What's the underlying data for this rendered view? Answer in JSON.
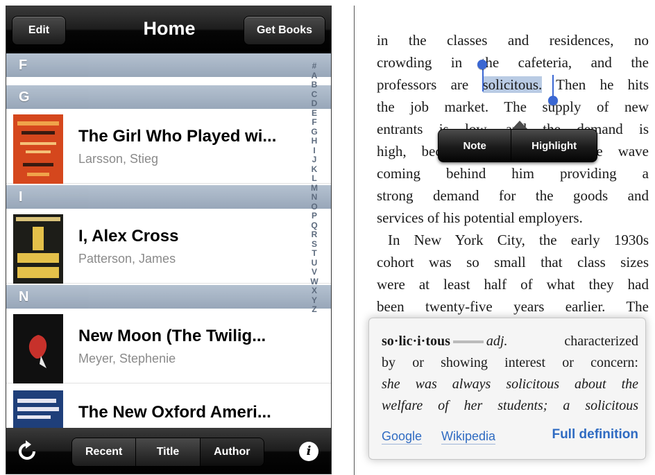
{
  "library": {
    "nav": {
      "edit": "Edit",
      "title": "Home",
      "get_books": "Get Books"
    },
    "sections": [
      "F",
      "G",
      "I",
      "N"
    ],
    "books": [
      {
        "title": "The Girl Who Played wi...",
        "author": "Larsson, Stieg",
        "cover_color": "#d5471d"
      },
      {
        "title": "I, Alex Cross",
        "author": "Patterson, James",
        "cover_color": "#1d1d18"
      },
      {
        "title": "New Moon (The Twilig...",
        "author": "Meyer, Stephenie",
        "cover_color": "#101010"
      },
      {
        "title": "The New Oxford Ameri...",
        "author": "",
        "cover_color": "#1f3f7a"
      }
    ],
    "index_letters": [
      "#",
      "A",
      "B",
      "C",
      "D",
      "E",
      "F",
      "G",
      "H",
      "I",
      "J",
      "K",
      "L",
      "M",
      "N",
      "O",
      "P",
      "Q",
      "R",
      "S",
      "T",
      "U",
      "V",
      "W",
      "X",
      "Y",
      "Z"
    ],
    "toolbar": {
      "segments": [
        "Recent",
        "Title",
        "Author"
      ],
      "active": "Author",
      "info_glyph": "i"
    },
    "icons": {
      "refresh": "refresh-icon",
      "info": "info-icon"
    }
  },
  "reader": {
    "lines": [
      "in the classes and residences, no",
      "crowding in the cafeteria, and the",
      "professors are solicitous. Then he hits",
      "the job market. The supply of new",
      "entrants is low, and the demand is",
      "high, because there is a large wave",
      "coming behind him providing a",
      "strong demand for the goods and",
      "services of his potential employers.",
      "In New York City, the early 1930s",
      "cohort was so small that class sizes",
      "were at least half of what they had",
      "been twenty-five years earlier. The"
    ],
    "selected_word": "solicitous.",
    "selection_prefix": "professors are ",
    "selection_suffix": " Then he hits",
    "popup": {
      "note": "Note",
      "highlight": "Highlight"
    },
    "dictionary": {
      "headword": "so·lic·i·tous",
      "pos": "adj.",
      "def_tail": " characterized",
      "line2": "by or showing interest or concern:",
      "line3": "she was always solicitous about the",
      "line4": "welfare of her students; a solicitous",
      "links": {
        "google": "Google",
        "wikipedia": "Wikipedia",
        "full": "Full definition"
      }
    },
    "accent_color": "#2f6bc2",
    "highlight_color": "#b9cbe4"
  }
}
